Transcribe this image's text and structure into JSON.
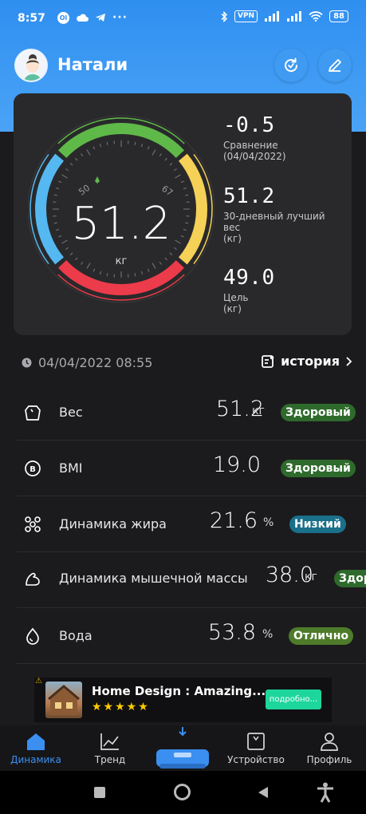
{
  "status_bar": {
    "time": "8:57",
    "left_icons": [
      "ola-icon",
      "cloud-icon",
      "telegram-icon",
      "more-icon"
    ],
    "vpn": "VPN",
    "battery": "88"
  },
  "header": {
    "user_name": "Натали"
  },
  "gauge": {
    "value": "51.2",
    "unit": "кг",
    "tick_low": "50",
    "tick_high": "67"
  },
  "stats": {
    "comparison": {
      "value": "-0.5",
      "label1": "Сравнение",
      "label2": "(04/04/2022)"
    },
    "best": {
      "value": "51.2",
      "label1": "30-дневный лучший",
      "label2": "вес",
      "label3": "(кг)"
    },
    "goal": {
      "value": "49.0",
      "label1": "Цель",
      "label2": "(кг)"
    }
  },
  "datetime": "04/04/2022 08:55",
  "history_label": "история",
  "metrics": [
    {
      "name": "Вес",
      "value": "51.2",
      "unit": "кг",
      "badge": "Здоровый",
      "color": "#2e6a2c"
    },
    {
      "name": "BMI",
      "value": "19.0",
      "unit": "",
      "badge": "Здоровый",
      "color": "#2e6a2c"
    },
    {
      "name": "Динамика жира",
      "value": "21.6",
      "unit": "%",
      "badge": "Низкий",
      "color": "#1a6f8a"
    },
    {
      "name": "Динамика мышечной массы",
      "value": "38.0",
      "unit": "кг",
      "badge": "Здоровый",
      "color": "#2e6a2c"
    },
    {
      "name": "Вода",
      "value": "53.8",
      "unit": "%",
      "badge": "Отлично",
      "color": "#4e7b2a"
    }
  ],
  "ad": {
    "title": "Home Design : Amazing...",
    "stars": "★★★★★",
    "cta": "подробно..."
  },
  "nav": [
    {
      "label": "Динамика",
      "active": true
    },
    {
      "label": "Тренд",
      "active": false
    },
    {
      "label": "",
      "active": false
    },
    {
      "label": "Устройство",
      "active": false
    },
    {
      "label": "Профиль",
      "active": false
    }
  ],
  "colors": {
    "accent": "#3a8ff0",
    "green": "#5fb949",
    "yellow": "#f6d157",
    "red": "#ec3b4a",
    "blue": "#55b8f0"
  }
}
